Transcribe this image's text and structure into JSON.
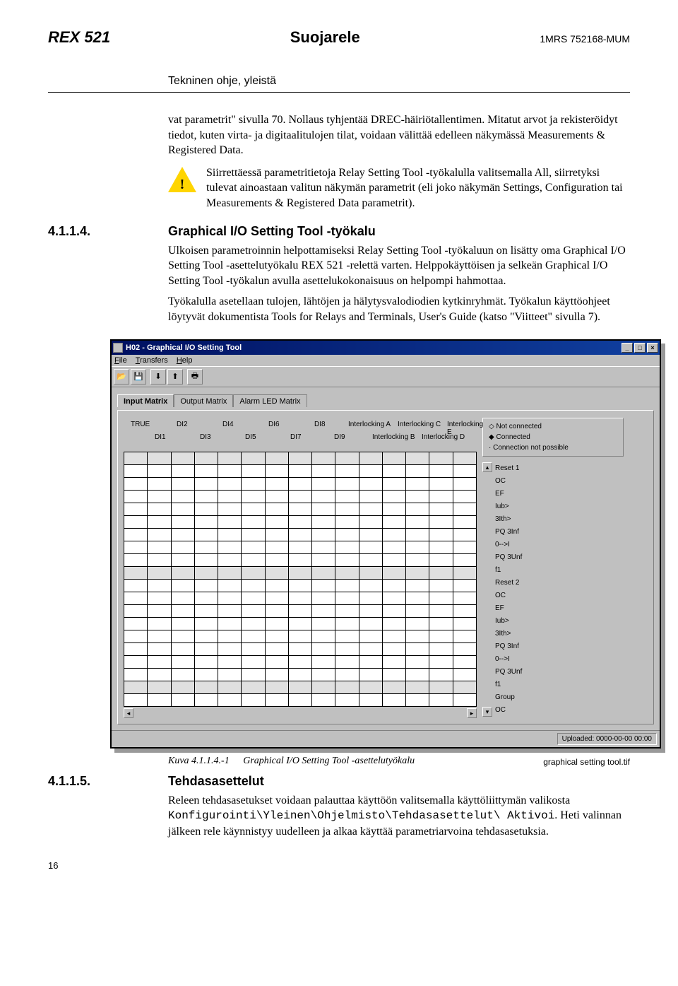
{
  "header": {
    "product": "REX 521",
    "title": "Suojarele",
    "code": "1MRS 752168-MUM",
    "subtitle": "Tekninen ohje, yleistä"
  },
  "intro": {
    "p1": "vat parametrit\" sivulla 70. Nollaus tyhjentää DREC-häiriötallentimen. Mitatut arvot ja rekisteröidyt tiedot, kuten virta- ja digitaalitulojen tilat, voidaan välittää edelleen näkymässä Measurements & Registered Data."
  },
  "warning": {
    "text": "Siirrettäessä parametritietoja Relay Setting Tool -työkalulla valitsemalla All, siirretyksi tulevat ainoastaan valitun näkymän parametrit (eli joko näkymän Settings, Configuration tai Measurements & Registered Data parametrit)."
  },
  "sec4114": {
    "num": "4.1.1.4.",
    "title": "Graphical I/O Setting Tool -työkalu",
    "p1": "Ulkoisen parametroinnin helpottamiseksi Relay Setting Tool -työkaluun on lisätty oma Graphical I/O Setting Tool -asettelutyökalu REX 521 -relettä varten. Helppokäyttöisen ja selkeän Graphical I/O Setting Tool -työkalun avulla asettelukokonaisuus on helpompi hahmottaa.",
    "p2": "Työkalulla asetellaan tulojen, lähtöjen ja hälytysvalodiodien kytkinryhmät. Työkalun käyttöohjeet löytyvät dokumentista Tools for Relays and Terminals, User's Guide (katso \"Viitteet\" sivulla 7)."
  },
  "app": {
    "title": "H02 - Graphical I/O Setting Tool",
    "menu": {
      "file": "File",
      "transfers": "Transfers",
      "help": "Help"
    },
    "tabs": {
      "input": "Input Matrix",
      "output": "Output Matrix",
      "alarm": "Alarm LED Matrix"
    },
    "cols_top": [
      "TRUE",
      "DI2",
      "DI4",
      "DI6",
      "DI8",
      "Interlocking A",
      "Interlocking C",
      "Interlocking E"
    ],
    "cols_bot": [
      "DI1",
      "DI3",
      "DI5",
      "DI7",
      "DI9",
      "Interlocking B",
      "Interlocking D"
    ],
    "legend": {
      "nc": "Not connected",
      "c": "Connected",
      "np": "Connection not possible"
    },
    "rows1_header": "Reset 1",
    "rows1": [
      "OC",
      "EF",
      "Iub>",
      "3Ith>",
      "PQ 3Inf",
      "0-->I",
      "PQ 3Unf",
      "f1"
    ],
    "rows2_header": "Reset 2",
    "rows2": [
      "OC",
      "EF",
      "Iub>",
      "3Ith>",
      "PQ 3Inf",
      "0-->I",
      "PQ 3Unf",
      "f1"
    ],
    "rows3_header": "Group",
    "rows3": [
      "OC"
    ],
    "status": "Uploaded: 0000-00-00 00:00"
  },
  "figure": {
    "num": "Kuva 4.1.1.4.-1",
    "caption": "Graphical I/O Setting Tool -asettelutyökalu",
    "filename": "graphical setting tool.tif"
  },
  "sec4115": {
    "num": "4.1.1.5.",
    "title": "Tehdasasettelut",
    "p1a": "Releen tehdasasetukset voidaan palauttaa käyttöön valitsemalla käyttöliittymän valikosta ",
    "p1mono": "Konfigurointi\\Yleinen\\Ohjelmisto\\Tehdasasettelut\\ Aktivoi",
    "p1b": ". Heti valinnan jälkeen rele käynnistyy uudelleen ja alkaa käyttää parametriarvoina tehdasasetuksia."
  },
  "page_num": "16"
}
